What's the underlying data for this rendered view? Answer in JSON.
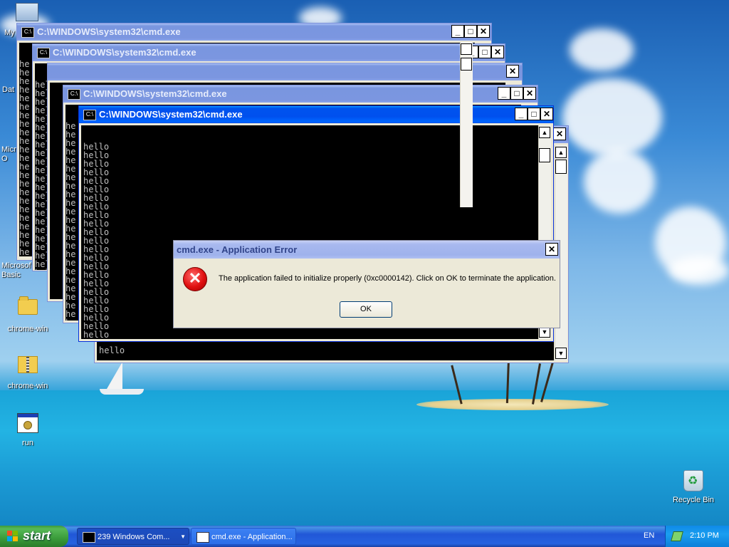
{
  "desktop": {
    "icons": [
      {
        "label": "My",
        "icon": "my-computer-icon"
      },
      {
        "label": "Dat",
        "icon": "document-icon"
      },
      {
        "label": "Micro O",
        "icon": "office-icon"
      },
      {
        "label": "Microsof Basic",
        "icon": "basic-icon"
      },
      {
        "label": "chrome-win",
        "icon": "folder-icon"
      },
      {
        "label": "chrome-win",
        "icon": "zip-folder-icon"
      },
      {
        "label": "run",
        "icon": "run-icon"
      },
      {
        "label": "Recycle Bin",
        "icon": "recycle-bin-icon"
      }
    ]
  },
  "cmd_windows": {
    "title": "C:\\WINDOWS\\system32\\cmd.exe",
    "icon_label": "C:\\",
    "console_line": "hello",
    "truncated_line": "he",
    "truncated_line_2": "hello"
  },
  "error_dialog": {
    "title": "cmd.exe - Application Error",
    "message": "The application failed to initialize properly (0xc0000142). Click on OK to terminate the application.",
    "ok_label": "OK",
    "close_label": "✕"
  },
  "taskbar": {
    "start_label": "start",
    "tasks": [
      {
        "label": "239 Windows Com...",
        "icon": "cmd-icon"
      },
      {
        "label": "cmd.exe - Application...",
        "icon": "window-icon"
      }
    ],
    "language": "EN",
    "clock": "2:10 PM"
  },
  "colors": {
    "title_active": "#0053ee",
    "title_inactive": "#7b96e0",
    "dialog_face": "#ece9d8",
    "taskbar": "#2157d7",
    "start_green": "#3a9b3a"
  }
}
